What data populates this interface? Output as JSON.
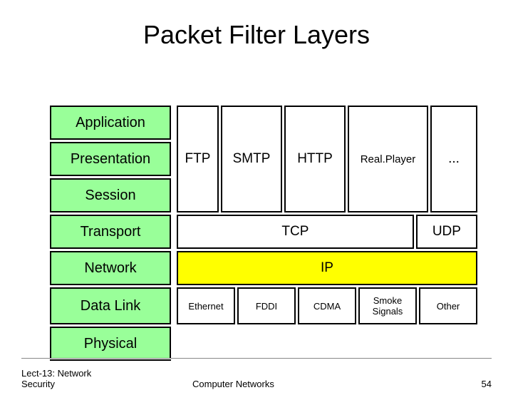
{
  "title": "Packet Filter Layers",
  "osi": {
    "application": "Application",
    "presentation": "Presentation",
    "session": "Session",
    "transport": "Transport",
    "network": "Network",
    "datalink": "Data Link",
    "physical": "Physical"
  },
  "app_protocols": {
    "ftp": "FTP",
    "smtp": "SMTP",
    "http": "HTTP",
    "realplayer": "Real.Player",
    "more": "..."
  },
  "transport_protocols": {
    "tcp": "TCP",
    "udp": "UDP"
  },
  "network_protocols": {
    "ip": "IP"
  },
  "link_protocols": {
    "ethernet": "Ethernet",
    "fddi": "FDDI",
    "cdma": "CDMA",
    "smoke": "Smoke Signals",
    "other": "Other"
  },
  "footer": {
    "left_a": "Lect-13: Network",
    "left_b": "Security",
    "center": "Computer Networks",
    "page": "54"
  }
}
